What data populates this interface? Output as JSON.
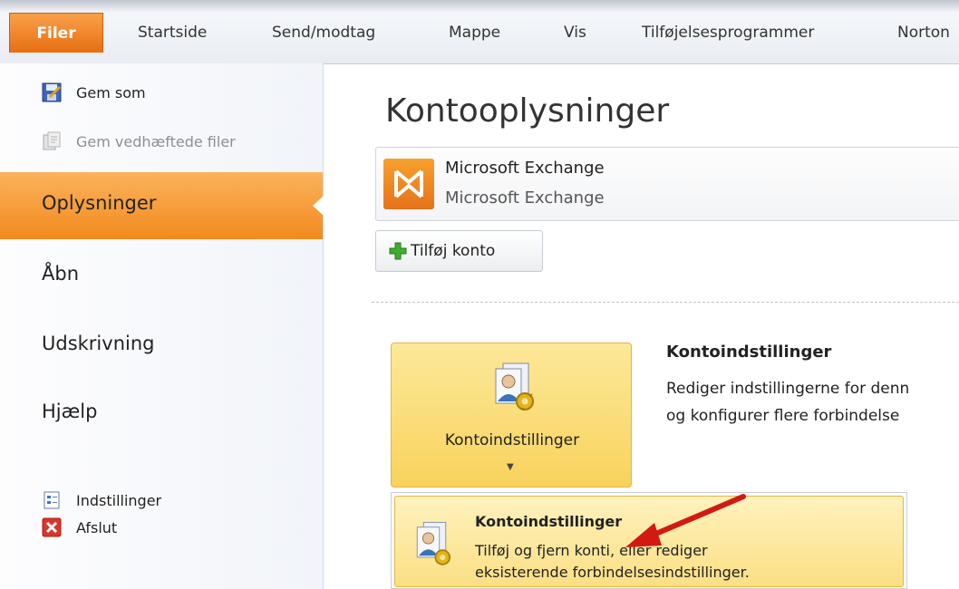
{
  "ribbon": {
    "file_tab": "Filer",
    "tabs": [
      "Startside",
      "Send/modtag",
      "Mappe",
      "Vis",
      "Tilføjelsesprogrammer",
      "Norton"
    ]
  },
  "backstage": {
    "commands": [
      {
        "label": "Gem som",
        "icon": "save-as-icon",
        "enabled": true
      },
      {
        "label": "Gem vedhæftede filer",
        "icon": "save-attachments-icon",
        "enabled": false
      }
    ],
    "selected": "Oplysninger",
    "nav": [
      "Åbn",
      "Udskrivning",
      "Hjælp"
    ],
    "bottom_commands": [
      {
        "label": "Indstillinger",
        "icon": "options-icon"
      },
      {
        "label": "Afslut",
        "icon": "exit-icon"
      }
    ]
  },
  "main": {
    "title": "Kontooplysninger",
    "account": {
      "name": "Microsoft Exchange",
      "type": "Microsoft Exchange",
      "icon": "exchange-icon"
    },
    "add_account": "Tilføj konto",
    "account_settings": {
      "button_label": "Kontoindstillinger",
      "heading": "Kontoindstillinger",
      "desc_line1": "Rediger indstillingerne for denn",
      "desc_line2": "og konfigurer flere forbindelse"
    },
    "dropdown": {
      "item_title": "Kontoindstillinger",
      "item_desc_line1": "Tilføj og fjern konti, eller rediger",
      "item_desc_line2": "eksisterende forbindelsesindstillinger."
    }
  },
  "colors": {
    "accent": "#f28a1e",
    "highlight": "#f8d35c",
    "arrow": "#d11a12"
  }
}
